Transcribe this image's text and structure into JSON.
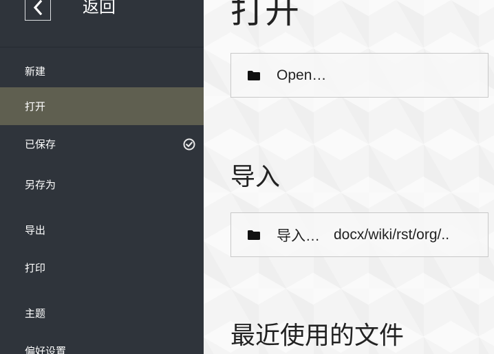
{
  "sidebar": {
    "back_label": "返回",
    "items": [
      {
        "label": "新建",
        "active": false
      },
      {
        "label": "打开",
        "active": true
      },
      {
        "label": "已保存",
        "active": false,
        "icon": "check-circle-icon"
      },
      {
        "label": "另存为",
        "active": false
      },
      {
        "label": "导出",
        "active": false
      },
      {
        "label": "打印",
        "active": false
      },
      {
        "label": "主题",
        "active": false
      },
      {
        "label": "偏好设置",
        "active": false
      }
    ],
    "colors": {
      "background": "#2f343b",
      "active": "#5f5f50"
    }
  },
  "main": {
    "open": {
      "title": "打开",
      "button_label": "Open…"
    },
    "import": {
      "title": "导入",
      "button_label": "导入…",
      "button_formats": "docx/wiki/rst/org/.."
    },
    "recent": {
      "title": "最近使用的文件"
    }
  }
}
